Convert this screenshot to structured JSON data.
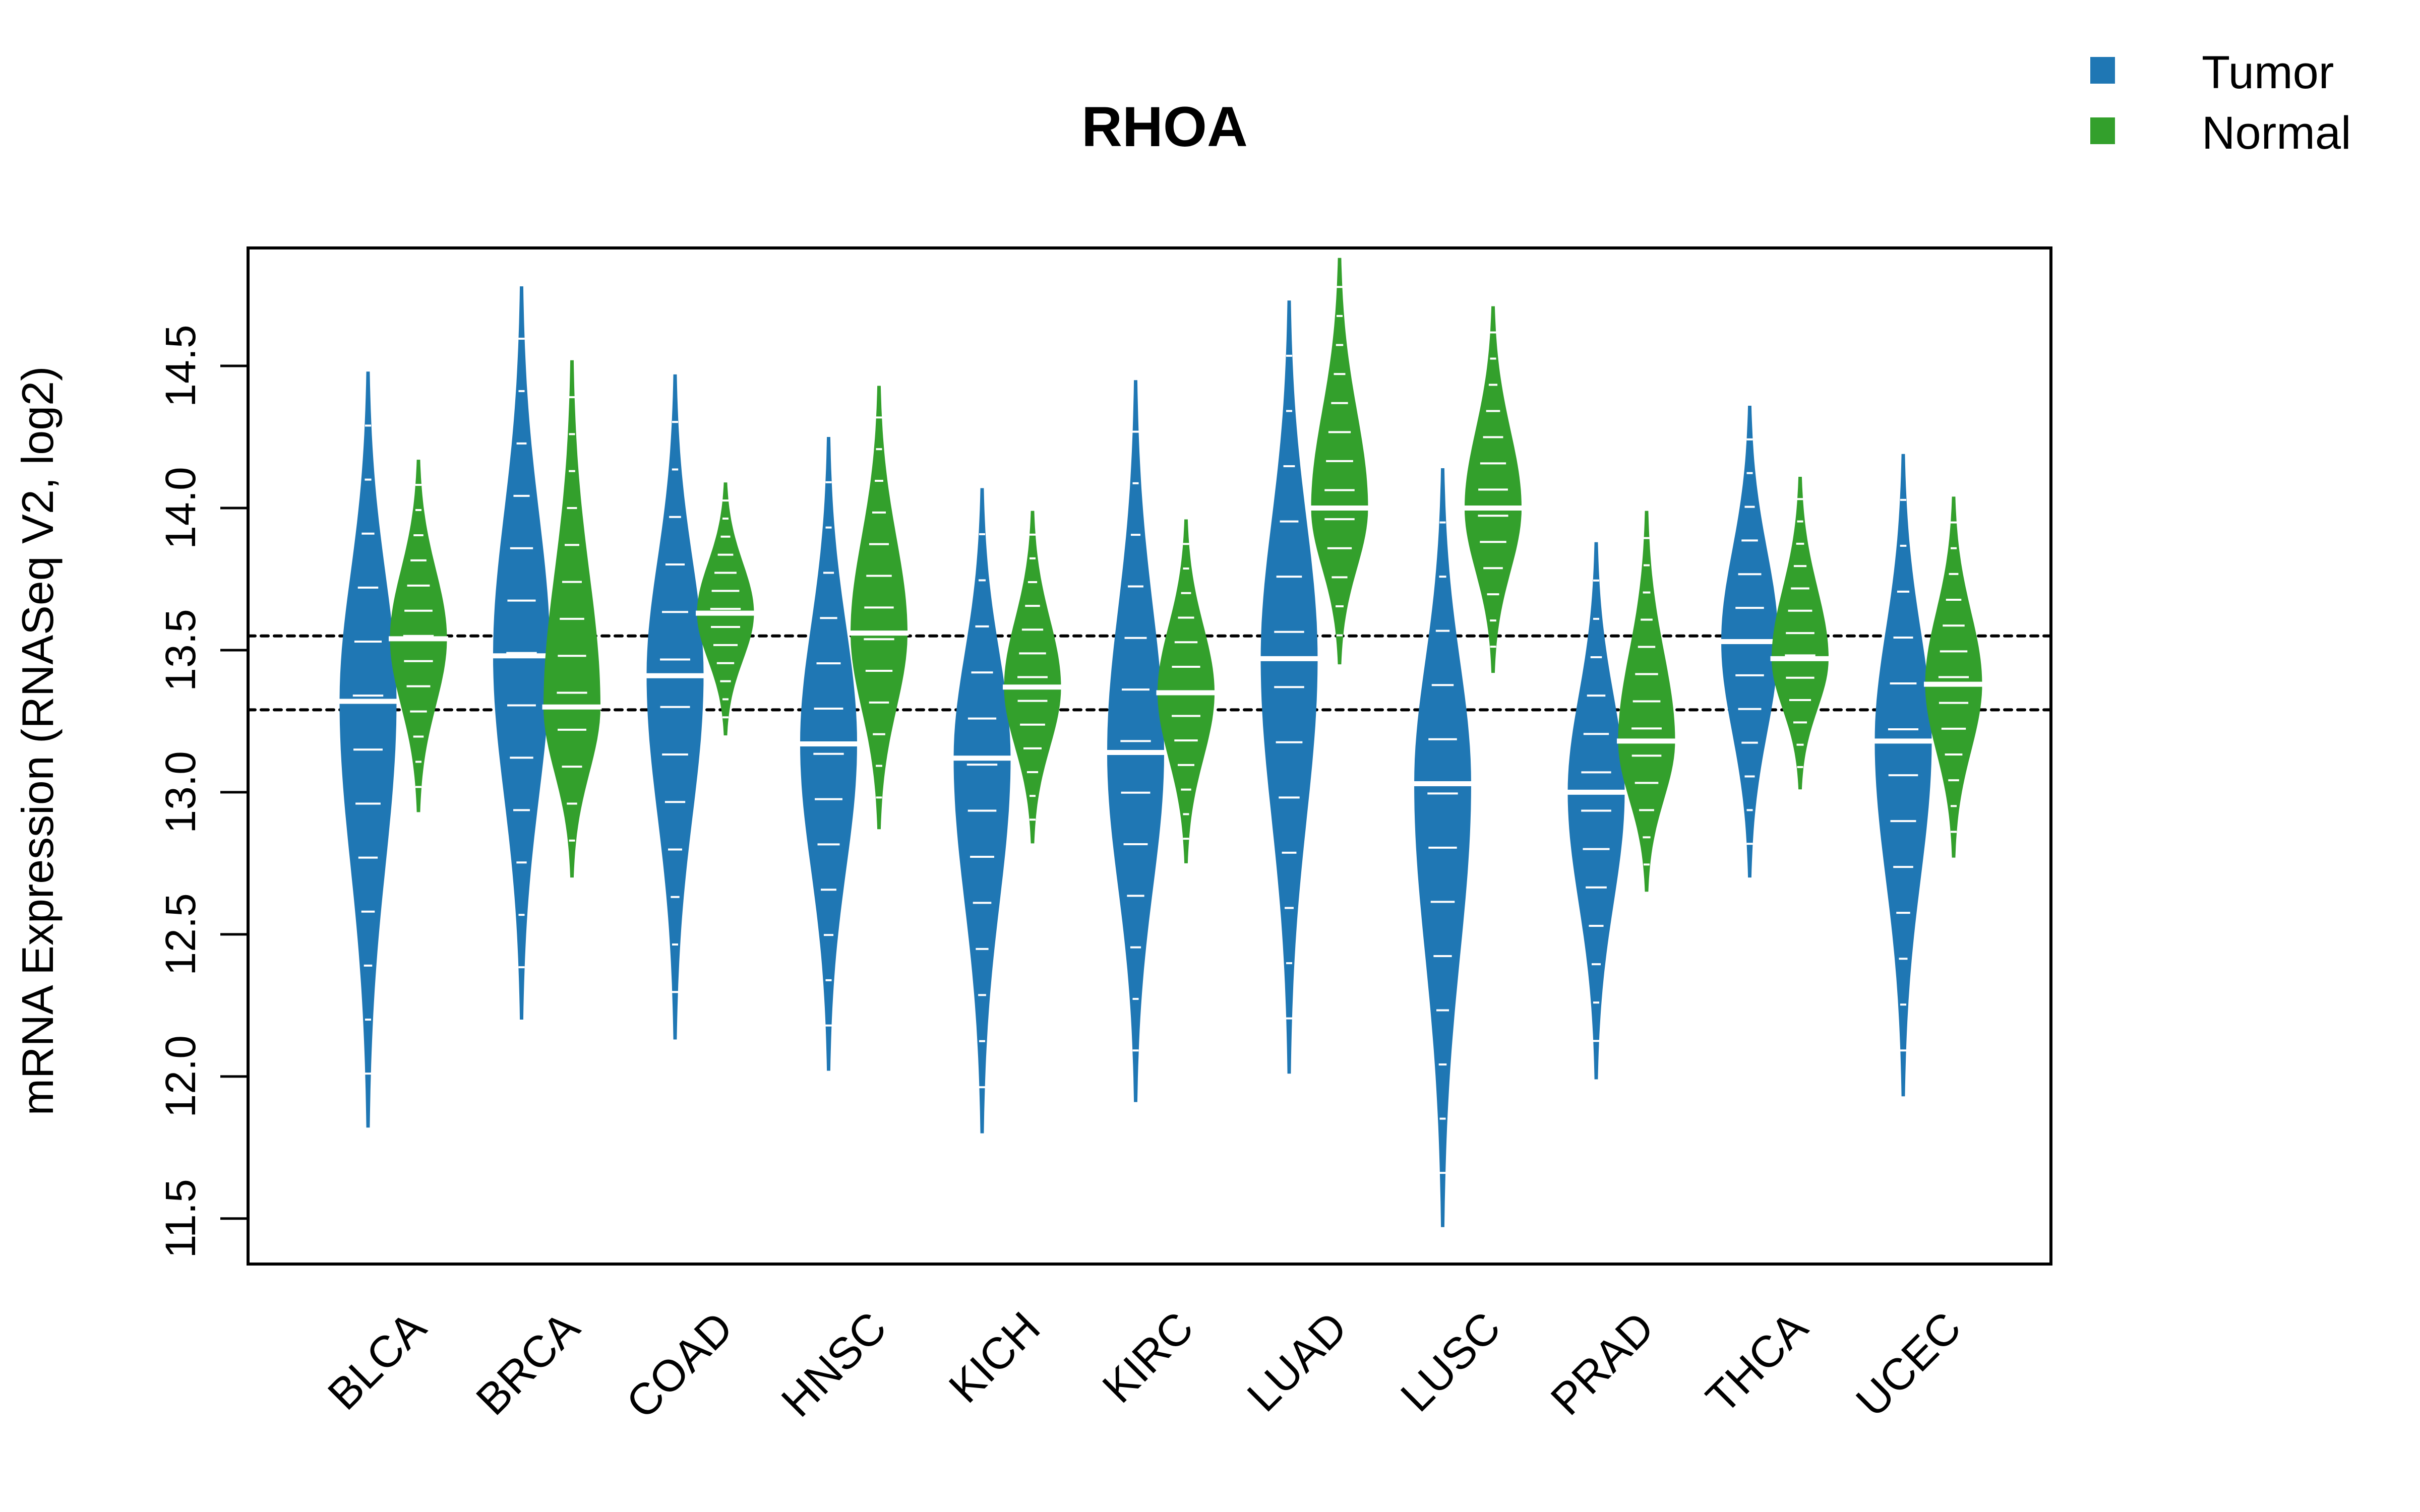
{
  "chart_data": {
    "type": "violin",
    "title": "RHOA",
    "xlabel": "",
    "ylabel": "mRNA Expression (RNASeq V2, log2)",
    "ylim": [
      11.34,
      14.915
    ],
    "yticks": [
      11.5,
      12.0,
      12.5,
      13.0,
      13.5,
      14.0,
      14.5
    ],
    "ytick_labels": [
      "11.5",
      "12.0",
      "12.5",
      "13.0",
      "13.5",
      "14.0",
      "14.5"
    ],
    "grid": false,
    "legend": {
      "position": "top-right",
      "entries": [
        {
          "name": "Tumor",
          "color": "#1f77b4"
        },
        {
          "name": "Normal",
          "color": "#33a02c"
        }
      ]
    },
    "reference_lines": [
      {
        "value": 13.55,
        "style": "dotted"
      },
      {
        "value": 13.29,
        "style": "dotted"
      }
    ],
    "categories": [
      "BLCA",
      "BRCA",
      "COAD",
      "HNSC",
      "KICH",
      "KIRC",
      "LUAD",
      "LUSC",
      "PRAD",
      "THCA",
      "UCEC"
    ],
    "series": [
      {
        "name": "Tumor",
        "color": "#1f77b4",
        "median": [
          13.32,
          13.48,
          13.41,
          13.17,
          13.12,
          13.14,
          13.47,
          13.03,
          13.0,
          13.53,
          13.18
        ],
        "min": [
          11.82,
          12.2,
          12.13,
          12.02,
          11.8,
          11.91,
          12.01,
          11.47,
          11.99,
          12.7,
          11.93
        ],
        "max": [
          14.48,
          14.78,
          14.47,
          14.25,
          14.07,
          14.45,
          14.73,
          14.14,
          13.88,
          14.36,
          14.19
        ]
      },
      {
        "name": "Normal",
        "color": "#33a02c",
        "median": [
          13.54,
          13.3,
          13.63,
          13.56,
          13.37,
          13.35,
          14.0,
          14.0,
          13.18,
          13.47,
          13.38
        ],
        "min": [
          12.93,
          12.7,
          13.2,
          12.87,
          12.82,
          12.75,
          13.45,
          13.42,
          12.65,
          13.01,
          12.77
        ],
        "max": [
          14.17,
          14.52,
          14.09,
          14.43,
          13.99,
          13.96,
          14.88,
          14.71,
          13.99,
          14.11,
          14.04
        ]
      }
    ]
  }
}
